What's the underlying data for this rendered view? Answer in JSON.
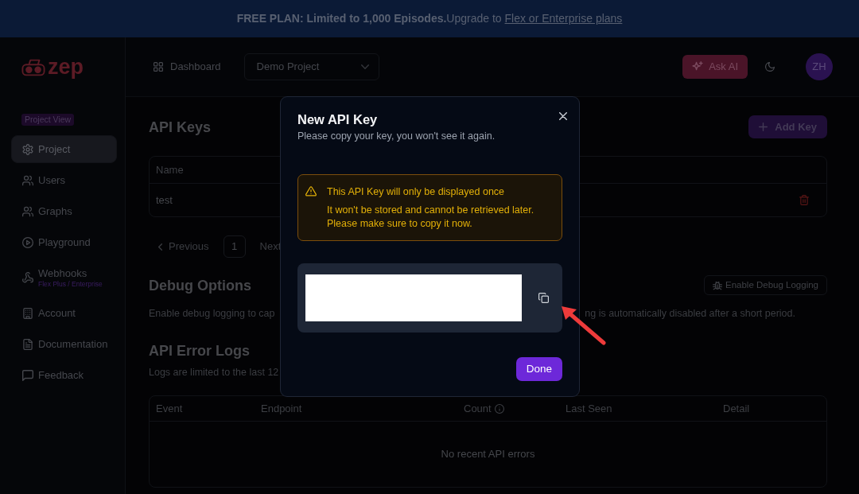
{
  "banner": {
    "message": "**FREE PLAN: Limited to 1,000 Episodes.**Upgrade to",
    "link": "Flex or Enterprise plans"
  },
  "header": {
    "logo": "zep",
    "nav": [
      {
        "label": "Dashboard"
      }
    ],
    "project_select": {
      "value": "Demo Project"
    },
    "ask_ai": "Ask AI",
    "avatar": "ZH"
  },
  "sidebar": {
    "badge": "Project View",
    "items": [
      {
        "label": "Project",
        "selected": true
      },
      {
        "label": "Users",
        "selected": false
      },
      {
        "label": "Graphs",
        "selected": false
      },
      {
        "label": "Playground",
        "selected": false
      },
      {
        "label": "Webhooks",
        "sublabel": "Flex Plus / Enterprise",
        "selected": false
      },
      {
        "label": "Account",
        "selected": false
      },
      {
        "label": "Documentation",
        "selected": false
      },
      {
        "label": "Feedback",
        "selected": false
      }
    ]
  },
  "api_keys": {
    "title": "API Keys",
    "add_button": "Add Key",
    "columns": [
      "Name"
    ],
    "rows": [
      {
        "name": "test"
      }
    ],
    "pagination": {
      "previous": "Previous",
      "pages": [
        {
          "label": "1",
          "selected": true
        }
      ],
      "next": "Next"
    }
  },
  "debug_options": {
    "title": "Debug Options",
    "button": "Enable Debug Logging",
    "description": [
      "Enable debug logging to cap",
      "ng is automatically disabled after a short period."
    ]
  },
  "error_logs": {
    "title": "API Error Logs",
    "note": "Logs are limited to the last 12",
    "columns": [
      {
        "label": "Event",
        "info": false
      },
      {
        "label": "Endpoint",
        "info": false
      },
      {
        "label": "Count",
        "info": true
      },
      {
        "label": "Last Seen",
        "info": false
      },
      {
        "label": "Detail",
        "info": false
      }
    ],
    "empty_message": "No recent API errors"
  },
  "modal": {
    "title": "New API Key",
    "subtitle": "Please copy your key, you won't see it again.",
    "alert": {
      "title": "This API Key will only be displayed once",
      "body": "It won't be stored and cannot be retrieved later. Please make sure to copy it now."
    },
    "api_key": {
      "redacted": true
    },
    "done_button": "Done"
  },
  "annotation": {
    "kind": "arrow"
  }
}
